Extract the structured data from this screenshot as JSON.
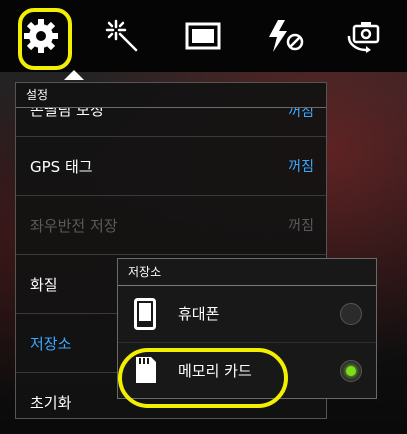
{
  "toolbar": {
    "items": [
      {
        "name": "settings-icon",
        "selected": true
      },
      {
        "name": "effects-icon"
      },
      {
        "name": "frame-icon"
      },
      {
        "name": "flash-off-icon"
      },
      {
        "name": "switch-camera-icon"
      }
    ]
  },
  "settings_panel": {
    "title": "설정",
    "rows": [
      {
        "label": "손떨림 보정",
        "value": "꺼짐",
        "state": "partially-visible"
      },
      {
        "label": "GPS 태그",
        "value": "꺼짐"
      },
      {
        "label": "좌우반전 저장",
        "value": "꺼짐",
        "state": "disabled"
      },
      {
        "label": "화질",
        "value": ""
      },
      {
        "label": "저장소",
        "value": "",
        "state": "active"
      },
      {
        "label": "초기화",
        "value": ""
      }
    ]
  },
  "storage_popup": {
    "title": "저장소",
    "options": [
      {
        "label": "휴대폰",
        "icon": "phone-icon",
        "selected": false
      },
      {
        "label": "메모리 카드",
        "icon": "memory-card-icon",
        "selected": true
      }
    ]
  },
  "colors": {
    "accent": "#3aa8ff",
    "highlight": "#f2f000",
    "radio_on": "#7be01a"
  }
}
